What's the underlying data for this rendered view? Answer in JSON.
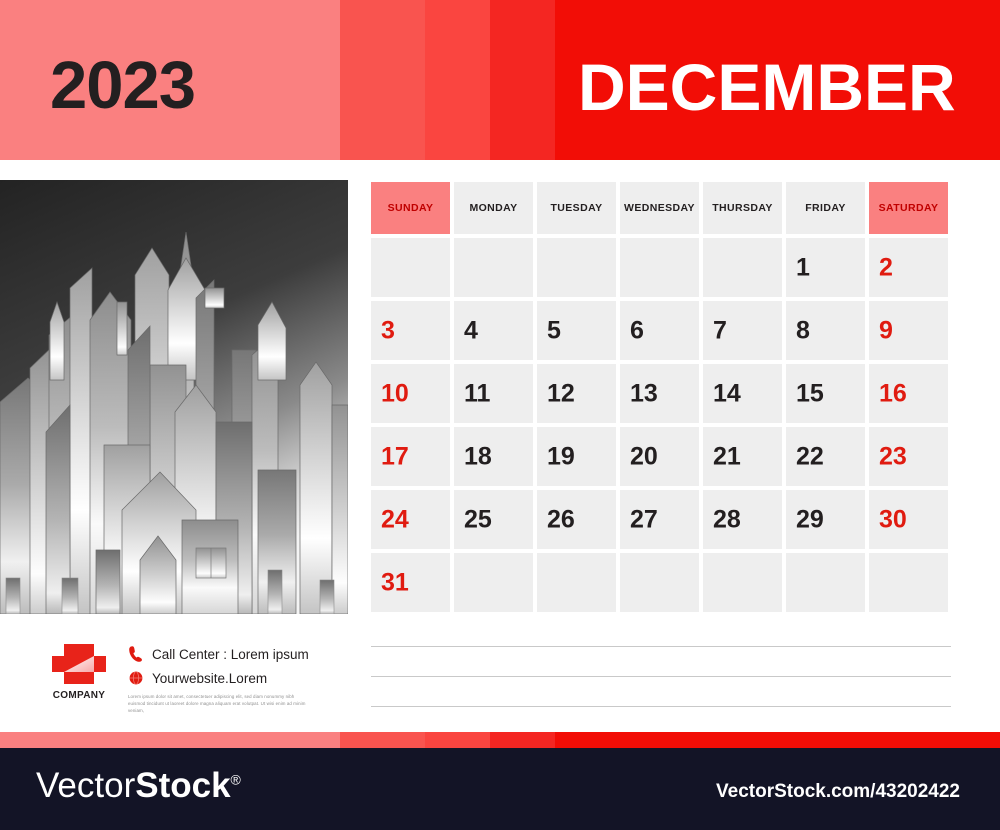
{
  "header": {
    "year": "2023",
    "month": "DECEMBER",
    "bands": [
      "#fa8080",
      "#f9544f",
      "#fa4540",
      "#f42622",
      "#f20d06"
    ]
  },
  "calendar": {
    "weekday_headers": [
      {
        "label": "SUNDAY",
        "weekend": true
      },
      {
        "label": "MONDAY",
        "weekend": false
      },
      {
        "label": "TUESDAY",
        "weekend": false
      },
      {
        "label": "WEDNESDAY",
        "weekend": false
      },
      {
        "label": "THURSDAY",
        "weekend": false
      },
      {
        "label": "FRIDAY",
        "weekend": false
      },
      {
        "label": "SATURDAY",
        "weekend": true
      }
    ],
    "weeks": [
      [
        {
          "day": "",
          "red": false
        },
        {
          "day": "",
          "red": false
        },
        {
          "day": "",
          "red": false
        },
        {
          "day": "",
          "red": false
        },
        {
          "day": "",
          "red": false
        },
        {
          "day": "1",
          "red": false
        },
        {
          "day": "2",
          "red": true
        }
      ],
      [
        {
          "day": "3",
          "red": true
        },
        {
          "day": "4",
          "red": false
        },
        {
          "day": "5",
          "red": false
        },
        {
          "day": "6",
          "red": false
        },
        {
          "day": "7",
          "red": false
        },
        {
          "day": "8",
          "red": false
        },
        {
          "day": "9",
          "red": true
        }
      ],
      [
        {
          "day": "10",
          "red": true
        },
        {
          "day": "11",
          "red": false
        },
        {
          "day": "12",
          "red": false
        },
        {
          "day": "13",
          "red": false
        },
        {
          "day": "14",
          "red": false
        },
        {
          "day": "15",
          "red": false
        },
        {
          "day": "16",
          "red": true
        }
      ],
      [
        {
          "day": "17",
          "red": true
        },
        {
          "day": "18",
          "red": false
        },
        {
          "day": "19",
          "red": false
        },
        {
          "day": "20",
          "red": false
        },
        {
          "day": "21",
          "red": false
        },
        {
          "day": "22",
          "red": false
        },
        {
          "day": "23",
          "red": true
        }
      ],
      [
        {
          "day": "24",
          "red": true
        },
        {
          "day": "25",
          "red": false
        },
        {
          "day": "26",
          "red": false
        },
        {
          "day": "27",
          "red": false
        },
        {
          "day": "28",
          "red": false
        },
        {
          "day": "29",
          "red": false
        },
        {
          "day": "30",
          "red": true
        }
      ],
      [
        {
          "day": "31",
          "red": true
        },
        {
          "day": "",
          "red": false
        },
        {
          "day": "",
          "red": false
        },
        {
          "day": "",
          "red": false
        },
        {
          "day": "",
          "red": false
        },
        {
          "day": "",
          "red": false
        },
        {
          "day": "",
          "red": false
        }
      ]
    ],
    "weekend_header_bg": "#fa8080",
    "weekend_text_color": "#c00000",
    "cell_bg": "#eeeeee",
    "day_red": "#e01b10"
  },
  "illustration": {
    "name": "city-skyline",
    "description": "Silver gradient city skyline silhouette on dark gray sky"
  },
  "brand": {
    "logo_name": "company-cross-logo",
    "company_label": "COMPANY",
    "phone_icon": "phone-icon",
    "web_icon": "globe-icon",
    "call_center": "Call Center : Lorem ipsum",
    "website": "Yourwebsite.Lorem",
    "lorem": "Lorem ipsum dolor sit amet, consectetuer adipiscing elit, sed diam nonummy nibh euismod tincidunt ut laoreet dolore magna aliquam erat volutpat. Ut wisi enim ad minim veniam,"
  },
  "notes": {
    "line_count": 3
  },
  "watermark": {
    "logo_light": "Vector",
    "logo_bold": "Stock",
    "registered": "®",
    "url": "VectorStock.com/43202422",
    "bg": "#131426"
  }
}
